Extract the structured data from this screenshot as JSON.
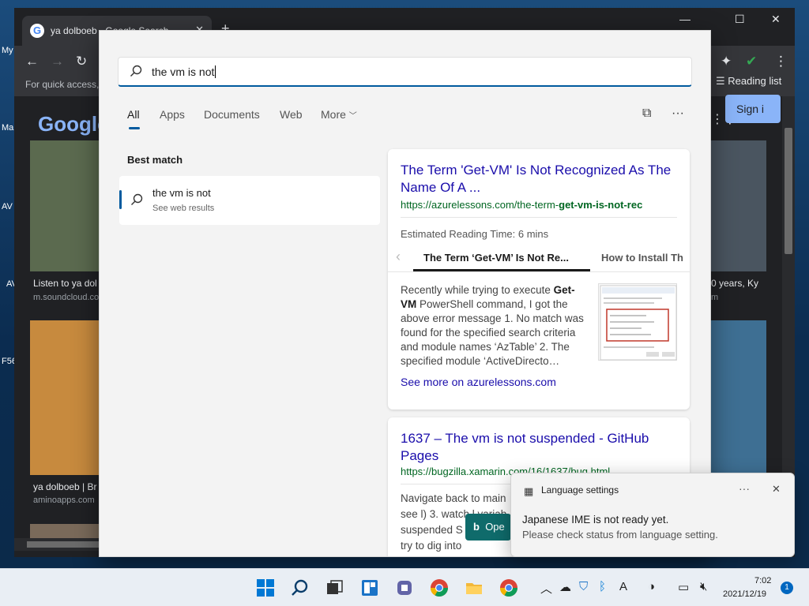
{
  "desktop": {
    "left_label_1": "My",
    "left_label_2": "Ma",
    "left_label_3": "AV",
    "left_label_4": "AV",
    "left_label_5": "F56"
  },
  "browser": {
    "tab_title": "ya dolboeb - Google Search",
    "bookmarks_hint": "For quick access,",
    "reading_list": "Reading list",
    "google_logo": "Google",
    "sign_in": "Sign i",
    "tiles": [
      {
        "caption": "Listen to ya dol",
        "source": "m.soundcloud.co"
      },
      {
        "caption": "ya dolboeb | Br",
        "source": "aminoapps.com"
      },
      {
        "caption": "0 years, Ky",
        "source": "m"
      }
    ]
  },
  "search": {
    "query": "the vm is not",
    "tabs": [
      "All",
      "Apps",
      "Documents",
      "Web",
      "More"
    ],
    "best_match_label": "Best match",
    "best_match_title": "the vm is not",
    "best_match_sub": "See web results",
    "result1": {
      "title": "The Term 'Get-VM' Is Not Recognized As The Name Of A ...",
      "url_prefix": "https://azurelessons.com/the-term-",
      "url_bold": "get-vm-is-not-rec",
      "reading_time": "Estimated Reading Time: 6 mins",
      "carousel_active": "The Term ‘Get-VM’ Is Not Re...",
      "carousel_next": "How to Install Th",
      "snippet_a": "Recently while trying to execute ",
      "snippet_b1": "Get-VM",
      "snippet_c": " PowerShell command, I got the above error message 1. No match was found for the specified search criteria and module names ‘AzTable’ 2. The specified module ‘ActiveDirecto…",
      "see_more": "See more on azurelessons.com"
    },
    "result2": {
      "title": "1637 – The vm is not suspended - GitHub Pages",
      "url": "https://bugzilla.xamarin.com/16/1637/bug.html",
      "snippet": "Navigate back to main see l) 3. watch l variab suspended S you can try to dig into"
    },
    "open_button": "Ope"
  },
  "toast": {
    "app": "Language settings",
    "message": "Japanese IME is not ready yet.",
    "sub": "Please check status from language setting."
  },
  "taskbar": {
    "time": "7:02",
    "date": "2021/12/19",
    "notifications": "1"
  }
}
